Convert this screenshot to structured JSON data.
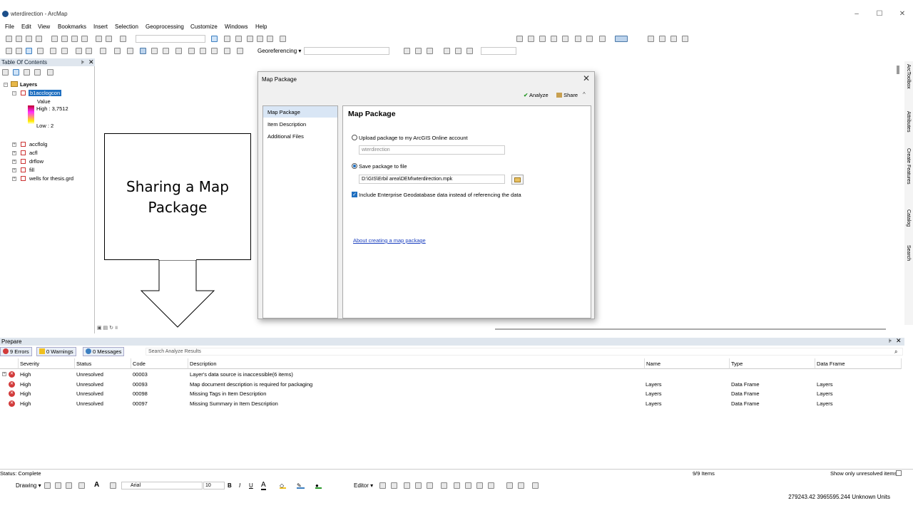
{
  "window": {
    "title": "wterdirection - ArcMap",
    "min": "–",
    "max": "☐",
    "close": "✕"
  },
  "menu": [
    "File",
    "Edit",
    "View",
    "Bookmarks",
    "Insert",
    "Selection",
    "Geoprocessing",
    "Customize",
    "Windows",
    "Help"
  ],
  "toolbar": {
    "georeferencing": "Georeferencing ▾"
  },
  "toc": {
    "title": "Table Of Contents",
    "root": "Layers",
    "selected_layer": "b1acclogcon",
    "legend_heading": "Value",
    "legend_high": "High : 3,7512",
    "legend_low": "Low : 2",
    "layers": [
      "accflolg",
      "acfl",
      "drflow",
      "fill",
      "wells for thesis.grd"
    ]
  },
  "callout": {
    "line1": "Sharing a Map",
    "line2": "Package"
  },
  "dialog": {
    "title": "Map Package",
    "analyze": "Analyze",
    "share": "Share",
    "nav": [
      "Map Package",
      "Item Description",
      "Additional Files"
    ],
    "heading": "Map Package",
    "upload_label": "Upload package to my ArcGIS Online account",
    "upload_value": "wterdirection",
    "save_label": "Save package to file",
    "save_path": "D:\\GIS\\Erbil area\\DEM\\wterdirection.mpk",
    "include_label": "Include Enterprise Geodatabase data instead of referencing the data",
    "link": "About creating a map package"
  },
  "prepare": {
    "title": "Prepare",
    "errors": "9 Errors",
    "warnings": "0 Warnings",
    "messages": "0 Messages",
    "search_placeholder": "Search Analyze Results",
    "columns": [
      "Severity",
      "Status",
      "Code",
      "Description",
      "Name",
      "Type",
      "Data Frame"
    ],
    "rows": [
      {
        "severity": "High",
        "status": "Unresolved",
        "code": "00003",
        "description": "Layer's data source is inaccessible(6 items)",
        "name": "",
        "type": "",
        "frame": ""
      },
      {
        "severity": "High",
        "status": "Unresolved",
        "code": "00093",
        "description": "Map document description is required for packaging",
        "name": "Layers",
        "type": "Data Frame",
        "frame": "Layers"
      },
      {
        "severity": "High",
        "status": "Unresolved",
        "code": "00098",
        "description": "Missing Tags in Item Description",
        "name": "Layers",
        "type": "Data Frame",
        "frame": "Layers"
      },
      {
        "severity": "High",
        "status": "Unresolved",
        "code": "00097",
        "description": "Missing Summary in Item Description",
        "name": "Layers",
        "type": "Data Frame",
        "frame": "Layers"
      }
    ]
  },
  "status": {
    "text": "Status: Complete",
    "items": "9/9 Items",
    "show_unresolved": "Show only unresolved items"
  },
  "drawing": {
    "drawing": "Drawing ▾",
    "font": "Arial",
    "size": "10",
    "editor": "Editor ▾",
    "bold": "B",
    "italic": "I",
    "underline": "U"
  },
  "coords": "279243.42  3965595.244 Unknown Units",
  "side_tabs": [
    "ArcToolbox",
    "Attributes",
    "Create Features",
    "Catalog",
    "Search"
  ],
  "colors": {
    "accent": "#1f6fc0",
    "error": "#d23b3b",
    "panel_head": "#dfe6ee"
  }
}
